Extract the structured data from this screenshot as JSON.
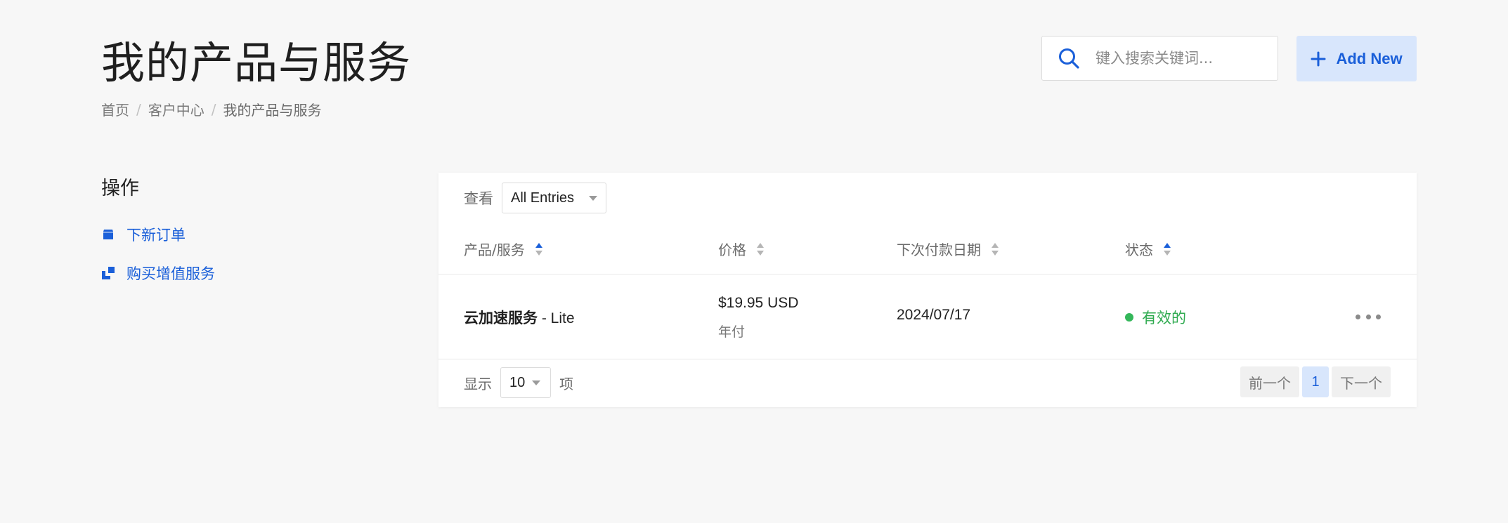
{
  "header": {
    "title": "我的产品与服务",
    "breadcrumb": [
      "首页",
      "客户中心",
      "我的产品与服务"
    ],
    "breadcrumb_separator": "/"
  },
  "search": {
    "placeholder": "键入搜索关键词...",
    "icon": "search-icon"
  },
  "toolbar": {
    "add_new_label": "Add New",
    "add_new_icon": "plus-icon"
  },
  "sidebar": {
    "title": "操作",
    "items": [
      {
        "label": "下新订单",
        "icon": "cart-icon"
      },
      {
        "label": "购买增值服务",
        "icon": "addon-icon"
      }
    ]
  },
  "filter": {
    "label": "查看",
    "selected": "All Entries"
  },
  "table": {
    "columns": [
      "产品/服务",
      "价格",
      "下次付款日期",
      "状态"
    ],
    "rows": [
      {
        "product_name": "云加速服务",
        "product_suffix": " - Lite",
        "price": "$19.95 USD",
        "billing_cycle": "年付",
        "next_due_date": "2024/07/17",
        "status": "有效的"
      }
    ]
  },
  "footer": {
    "show_label": "显示",
    "page_size": "10",
    "items_label": "项",
    "prev_label": "前一个",
    "current_page": "1",
    "next_label": "下一个"
  },
  "colors": {
    "accent": "#1a5fd9",
    "accent_bg": "#d8e6fc",
    "status_active": "#2eaa4f",
    "background": "#f7f7f7"
  }
}
